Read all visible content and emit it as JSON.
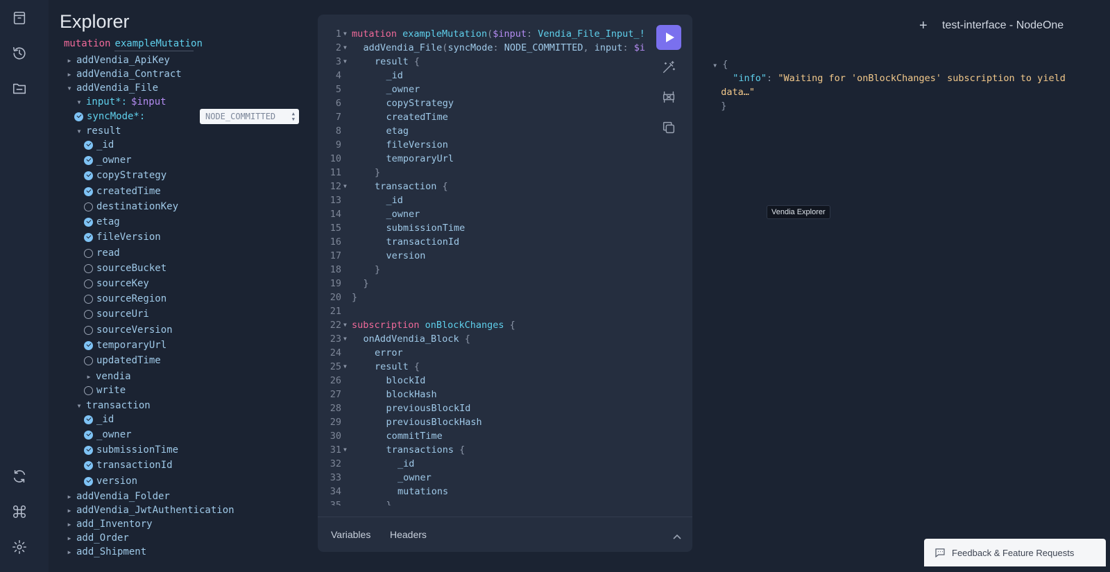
{
  "rail": {
    "icons": [
      "docs-icon",
      "history-icon",
      "explorer-icon",
      "refresh-icon",
      "shortcuts-icon",
      "settings-icon"
    ]
  },
  "explorer": {
    "title": "Explorer",
    "operation_keyword": "mutation",
    "operation_name": "exampleMutation",
    "tree": [
      {
        "label": "addVendia_ApiKey",
        "kind": "collapsed"
      },
      {
        "label": "addVendia_Contract",
        "kind": "collapsed"
      },
      {
        "label": "addVendia_File",
        "kind": "expanded"
      },
      {
        "label": "input*:",
        "value": "$input",
        "kind": "arg"
      },
      {
        "label": "syncMode*:",
        "kind": "arg-checked",
        "select_value": "NODE_COMMITTED"
      },
      {
        "label": "result",
        "kind": "expanded-sub"
      },
      {
        "label": "_id",
        "checked": true
      },
      {
        "label": "_owner",
        "checked": true
      },
      {
        "label": "copyStrategy",
        "checked": true
      },
      {
        "label": "createdTime",
        "checked": true
      },
      {
        "label": "destinationKey",
        "checked": false
      },
      {
        "label": "etag",
        "checked": true
      },
      {
        "label": "fileVersion",
        "checked": true
      },
      {
        "label": "read",
        "checked": false
      },
      {
        "label": "sourceBucket",
        "checked": false
      },
      {
        "label": "sourceKey",
        "checked": false
      },
      {
        "label": "sourceRegion",
        "checked": false
      },
      {
        "label": "sourceUri",
        "checked": false
      },
      {
        "label": "sourceVersion",
        "checked": false
      },
      {
        "label": "temporaryUrl",
        "checked": true
      },
      {
        "label": "updatedTime",
        "checked": false
      },
      {
        "label": "vendia",
        "kind": "collapsed-leaf"
      },
      {
        "label": "write",
        "checked": false
      },
      {
        "label": "transaction",
        "kind": "expanded-sub"
      },
      {
        "label": "_id",
        "checked": true
      },
      {
        "label": "_owner",
        "checked": true
      },
      {
        "label": "submissionTime",
        "checked": true
      },
      {
        "label": "transactionId",
        "checked": true
      },
      {
        "label": "version",
        "checked": true
      },
      {
        "label": "addVendia_Folder",
        "kind": "collapsed"
      },
      {
        "label": "addVendia_JwtAuthentication",
        "kind": "collapsed"
      },
      {
        "label": "add_Inventory",
        "kind": "collapsed"
      },
      {
        "label": "add_Order",
        "kind": "collapsed"
      },
      {
        "label": "add_Shipment",
        "kind": "collapsed"
      }
    ]
  },
  "editor": {
    "lines": [
      {
        "n": "1",
        "fold": true,
        "indent": 0,
        "parts": [
          [
            "k",
            "mutation "
          ],
          [
            "n",
            "exampleMutation"
          ],
          [
            "p",
            "("
          ],
          [
            "v",
            "$input"
          ],
          [
            "p",
            ": "
          ],
          [
            "t",
            "Vendia_File_Input_!"
          ]
        ]
      },
      {
        "n": "2",
        "fold": true,
        "indent": 1,
        "parts": [
          [
            "f",
            "addVendia_File"
          ],
          [
            "p",
            "("
          ],
          [
            "e",
            "syncMode"
          ],
          [
            "p",
            ": "
          ],
          [
            "e",
            "NODE_COMMITTED"
          ],
          [
            "p",
            ", "
          ],
          [
            "e",
            "input"
          ],
          [
            "p",
            ": "
          ],
          [
            "v",
            "$i"
          ]
        ]
      },
      {
        "n": "3",
        "fold": true,
        "indent": 2,
        "parts": [
          [
            "f",
            "result "
          ],
          [
            "p",
            "{"
          ]
        ]
      },
      {
        "n": "4",
        "indent": 3,
        "parts": [
          [
            "f",
            "_id"
          ]
        ]
      },
      {
        "n": "5",
        "indent": 3,
        "parts": [
          [
            "f",
            "_owner"
          ]
        ]
      },
      {
        "n": "6",
        "indent": 3,
        "parts": [
          [
            "f",
            "copyStrategy"
          ]
        ]
      },
      {
        "n": "7",
        "indent": 3,
        "parts": [
          [
            "f",
            "createdTime"
          ]
        ]
      },
      {
        "n": "8",
        "indent": 3,
        "parts": [
          [
            "f",
            "etag"
          ]
        ]
      },
      {
        "n": "9",
        "indent": 3,
        "parts": [
          [
            "f",
            "fileVersion"
          ]
        ]
      },
      {
        "n": "10",
        "indent": 3,
        "parts": [
          [
            "f",
            "temporaryUrl"
          ]
        ]
      },
      {
        "n": "11",
        "indent": 2,
        "parts": [
          [
            "p",
            "}"
          ]
        ]
      },
      {
        "n": "12",
        "fold": true,
        "indent": 2,
        "parts": [
          [
            "f",
            "transaction "
          ],
          [
            "p",
            "{"
          ]
        ]
      },
      {
        "n": "13",
        "indent": 3,
        "parts": [
          [
            "f",
            "_id"
          ]
        ]
      },
      {
        "n": "14",
        "indent": 3,
        "parts": [
          [
            "f",
            "_owner"
          ]
        ]
      },
      {
        "n": "15",
        "indent": 3,
        "parts": [
          [
            "f",
            "submissionTime"
          ]
        ]
      },
      {
        "n": "16",
        "indent": 3,
        "parts": [
          [
            "f",
            "transactionId"
          ]
        ]
      },
      {
        "n": "17",
        "indent": 3,
        "parts": [
          [
            "f",
            "version"
          ]
        ]
      },
      {
        "n": "18",
        "indent": 2,
        "parts": [
          [
            "p",
            "}"
          ]
        ]
      },
      {
        "n": "19",
        "indent": 1,
        "parts": [
          [
            "p",
            "}"
          ]
        ]
      },
      {
        "n": "20",
        "indent": 0,
        "parts": [
          [
            "p",
            "}"
          ]
        ]
      },
      {
        "n": "21",
        "indent": 0,
        "parts": []
      },
      {
        "n": "22",
        "fold": true,
        "indent": 0,
        "parts": [
          [
            "k",
            "subscription "
          ],
          [
            "n",
            "onBlockChanges "
          ],
          [
            "p",
            "{"
          ]
        ]
      },
      {
        "n": "23",
        "fold": true,
        "indent": 1,
        "parts": [
          [
            "f",
            "onAddVendia_Block "
          ],
          [
            "p",
            "{"
          ]
        ]
      },
      {
        "n": "24",
        "indent": 2,
        "parts": [
          [
            "f",
            "error"
          ]
        ]
      },
      {
        "n": "25",
        "fold": true,
        "indent": 2,
        "parts": [
          [
            "f",
            "result "
          ],
          [
            "p",
            "{"
          ]
        ]
      },
      {
        "n": "26",
        "indent": 3,
        "parts": [
          [
            "f",
            "blockId"
          ]
        ]
      },
      {
        "n": "27",
        "indent": 3,
        "parts": [
          [
            "f",
            "blockHash"
          ]
        ]
      },
      {
        "n": "28",
        "indent": 3,
        "parts": [
          [
            "f",
            "previousBlockId"
          ]
        ]
      },
      {
        "n": "29",
        "indent": 3,
        "parts": [
          [
            "f",
            "previousBlockHash"
          ]
        ]
      },
      {
        "n": "30",
        "indent": 3,
        "parts": [
          [
            "f",
            "commitTime"
          ]
        ]
      },
      {
        "n": "31",
        "fold": true,
        "indent": 3,
        "parts": [
          [
            "f",
            "transactions "
          ],
          [
            "p",
            "{"
          ]
        ]
      },
      {
        "n": "32",
        "indent": 4,
        "parts": [
          [
            "f",
            "_id"
          ]
        ]
      },
      {
        "n": "33",
        "indent": 4,
        "parts": [
          [
            "f",
            "_owner"
          ]
        ]
      },
      {
        "n": "34",
        "indent": 4,
        "parts": [
          [
            "f",
            "mutations"
          ]
        ]
      },
      {
        "n": "35",
        "indent": 3,
        "parts": [
          [
            "p",
            "}"
          ]
        ]
      }
    ],
    "footer_tabs": [
      "Variables",
      "Headers"
    ]
  },
  "response": {
    "tab_title": "test-interface - NodeOne",
    "add_label": "+",
    "open_brace": "{",
    "key": "\"info\"",
    "colon": ": ",
    "value_line1": "\"Waiting for 'onBlockChanges' subscription to yield",
    "value_line2": "data…\"",
    "close_brace": "}"
  },
  "tooltip": "Vendia Explorer",
  "feedback_label": "Feedback & Feature Requests"
}
